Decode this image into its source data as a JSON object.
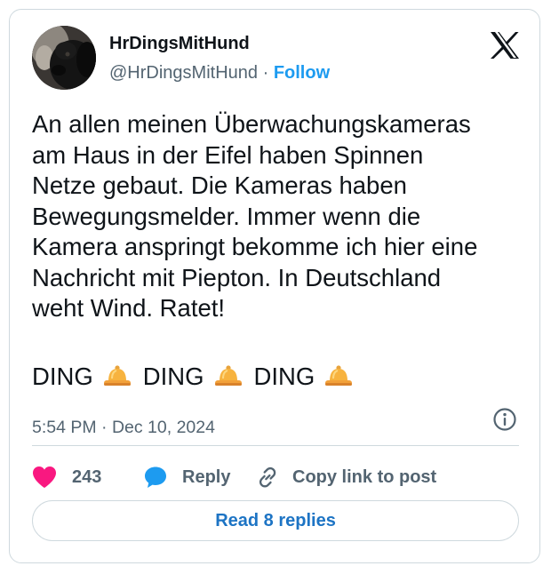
{
  "author": {
    "name": "HrDingsMitHund",
    "handle": "@HrDingsMitHund",
    "separator": "·",
    "follow_label": "Follow"
  },
  "tweet": {
    "text": "An allen meinen Überwachungskameras\nam Haus in der Eifel haben Spinnen\nNetze gebaut. Die Kameras haben\nBewegungsmelder. Immer wenn die\nKamera anspringt bekomme ich hier eine\nNachricht mit Piepton. In Deutschland\nweht Wind. Ratet!",
    "ding_words": [
      "DING",
      "DING",
      "DING"
    ],
    "ding_icon": "bell-emoji",
    "timestamp": "5:54 PM · Dec 10, 2024"
  },
  "actions": {
    "like_count": "243",
    "reply_label": "Reply",
    "copy_label": "Copy link to post"
  },
  "replies_button": "Read 8 replies",
  "colors": {
    "accent": "#1d9bf0",
    "like": "#f91880",
    "muted": "#536471",
    "border": "#cfd9de"
  },
  "icons": {
    "brand": "x-logo-icon",
    "info": "info-icon",
    "like": "heart-icon",
    "reply": "speech-bubble-icon",
    "copy": "link-icon"
  }
}
